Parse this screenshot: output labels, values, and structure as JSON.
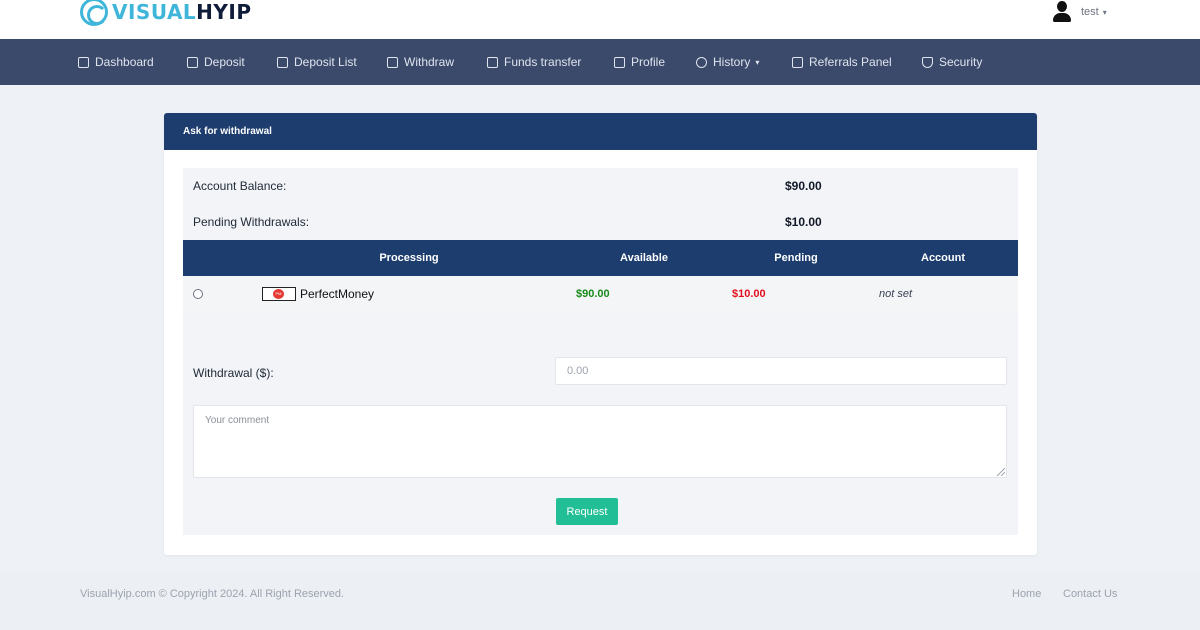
{
  "brand": {
    "part1": "VISUAL",
    "part2": "HYIP"
  },
  "user": {
    "name": "test",
    "caret": "▾"
  },
  "nav": [
    {
      "label": "Dashboard"
    },
    {
      "label": "Deposit"
    },
    {
      "label": "Deposit List"
    },
    {
      "label": "Withdraw"
    },
    {
      "label": "Funds transfer"
    },
    {
      "label": "Profile"
    },
    {
      "label": "History"
    },
    {
      "label": "Referrals Panel"
    },
    {
      "label": "Security"
    }
  ],
  "card": {
    "title": "Ask for withdrawal"
  },
  "balance": {
    "account_label": "Account Balance:",
    "account_value": "$90.00",
    "pending_label": "Pending Withdrawals:",
    "pending_value": "$10.00"
  },
  "table": {
    "headers": [
      "Processing",
      "Available",
      "Pending",
      "Account"
    ],
    "rows": [
      {
        "processor": "PerfectMoney",
        "available": "$90.00",
        "pending": "$10.00",
        "account": "not set"
      }
    ]
  },
  "form": {
    "withdrawal_label": "Withdrawal ($):",
    "withdrawal_placeholder": "0.00",
    "comment_placeholder": "Your comment",
    "submit_label": "Request"
  },
  "footer": {
    "copyright": "VisualHyip.com © Copyright 2024. All Right Reserved.",
    "links": [
      "Home",
      "Contact Us"
    ]
  },
  "colors": {
    "nav_bg": "#3b4a6b",
    "header_bg": "#1c3d6e",
    "accent": "#22bf96",
    "available": "#1a8a1a",
    "pending": "#e3101e"
  }
}
